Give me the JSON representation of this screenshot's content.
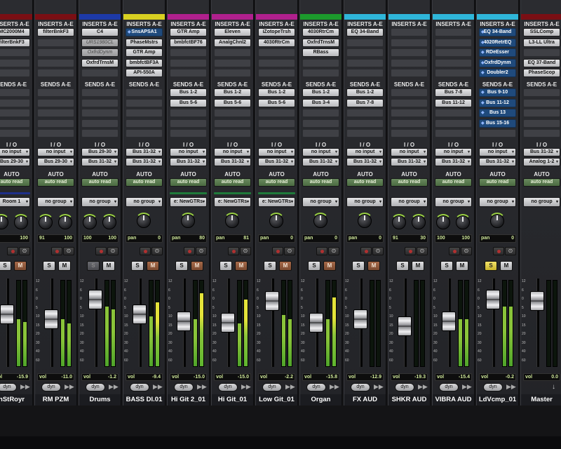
{
  "labels": {
    "inserts": "INSERTS A-E",
    "sends": "SENDS A-E",
    "io": "I / O",
    "auto": "AUTO",
    "vol": "vol",
    "dyn": "dyn"
  },
  "colors": {
    "accent_meter": "#8ac43a",
    "peak_meter": "#e4e33a",
    "selected_slot": "#1f4a7c"
  },
  "channels": [
    {
      "name": "nStRoyr",
      "color": "#7a0f14",
      "inserts": [
        "MC2000M4",
        "filterBnkF3",
        "",
        "",
        ""
      ],
      "sends": [
        "",
        "",
        "",
        "",
        ""
      ],
      "input": "no input",
      "output": "Bus 29-30",
      "auto": "auto read",
      "group": "Room 1",
      "group_stripe": "#1e2f8a",
      "pan_l": "7",
      "pan_r": "100",
      "solo": "S",
      "mute": "M",
      "vol": "-15.9",
      "fader": 0.62,
      "meters": [
        0.55,
        0.52
      ],
      "meter_peak": 0.0
    },
    {
      "name": "RM PZM",
      "color": "#7a0f14",
      "inserts": [
        "filterBnkF3",
        "",
        "",
        "",
        ""
      ],
      "sends": [
        "",
        "",
        "",
        "",
        ""
      ],
      "input": "no input",
      "output": "Bus 29-30",
      "auto": "auto read",
      "group": "no group",
      "group_stripe": "",
      "pan_l": "91",
      "pan_r": "100",
      "solo": "S",
      "mute": "M",
      "vol": "-11.0",
      "fader": 0.55,
      "meters": [
        0.55,
        0.5
      ],
      "meter_peak": 0.0
    },
    {
      "name": "Drums",
      "color": "#1d3aa8",
      "inserts": [
        "C4",
        "URS1980CL",
        "OxfrdDynm",
        "OxfrdTrnsM",
        ""
      ],
      "sends": [
        "",
        "",
        "",
        "",
        ""
      ],
      "input": "Bus 29-30",
      "output": "Bus 31-32",
      "auto": "auto read",
      "group": "no group",
      "group_stripe": "",
      "pan_l": "100",
      "pan_r": "100",
      "solo": "S",
      "mute": "M",
      "vol": "-1.2",
      "fader": 0.82,
      "meters": [
        0.7,
        0.66
      ],
      "meter_peak": 0.0
    },
    {
      "name": "BASS DI.01",
      "color": "#d8d021",
      "inserts": [
        "SnsAPSA1",
        "PhaseMstrs",
        "GTR Amp",
        "bmbfctBF3A",
        "API-550A"
      ],
      "sends": [
        "",
        "",
        "",
        "",
        ""
      ],
      "input": "Bus 31-32",
      "output": "Bus 31-32",
      "auto": "auto read",
      "group": "no group",
      "group_stripe": "",
      "pan_l": "pan",
      "pan_r": "0",
      "solo": "S",
      "mute": "M",
      "vol": "-9.4",
      "fader": 0.62,
      "meters": [
        0.58,
        0.75
      ],
      "meter_peak": 1.0
    },
    {
      "name": "Hi Git 2_01",
      "color": "#b0208d",
      "inserts": [
        "GTR Amp",
        "bmbfctBF76",
        "",
        "",
        ""
      ],
      "sends": [
        "Bus 1-2",
        "Bus 5-6",
        "",
        "",
        ""
      ],
      "input": "no input",
      "output": "Bus 31-32",
      "auto": "auto read",
      "group": "e: NewGTRs",
      "group_stripe": "#1f7a3a",
      "pan_l": "pan",
      "pan_r": "80",
      "solo": "S",
      "mute": "M",
      "vol": "-15.0",
      "fader": 0.52,
      "meters": [
        0.55,
        0.85
      ],
      "meter_peak": 1.0
    },
    {
      "name": "Hi Git_01",
      "color": "#b0208d",
      "inserts": [
        "Eleven",
        "AnalgChnl2",
        "",
        "",
        ""
      ],
      "sends": [
        "Bus 1-2",
        "Bus 5-6",
        "",
        "",
        ""
      ],
      "input": "no input",
      "output": "Bus 31-32",
      "auto": "auto read",
      "group": "e: NewGTRs",
      "group_stripe": "#1f7a3a",
      "pan_l": "pan",
      "pan_r": "81",
      "solo": "S",
      "mute": "M",
      "vol": "-15.0",
      "fader": 0.5,
      "meters": [
        0.5,
        0.78
      ],
      "meter_peak": 1.0
    },
    {
      "name": "Low Git_01",
      "color": "#b0208d",
      "inserts": [
        "iZotopeTrsh",
        "4030RtrCm",
        "",
        "",
        ""
      ],
      "sends": [
        "Bus 1-2",
        "Bus 5-6",
        "",
        "",
        ""
      ],
      "input": "no input",
      "output": "Bus 31-32",
      "auto": "auto read",
      "group": "e: NewGTRs",
      "group_stripe": "#1f7a3a",
      "pan_l": "pan",
      "pan_r": "0",
      "solo": "S",
      "mute": "M",
      "vol": "-2.2",
      "fader": 0.8,
      "meters": [
        0.6,
        0.55
      ],
      "meter_peak": 0.0
    },
    {
      "name": "Organ",
      "color": "#1c9a2c",
      "inserts": [
        "4030RtrCm",
        "OxfrdTrnsM",
        "RBass",
        "",
        ""
      ],
      "sends": [
        "Bus 1-2",
        "Bus 3-4",
        "",
        "",
        ""
      ],
      "input": "no input",
      "output": "Bus 31-32",
      "auto": "auto read",
      "group": "no group",
      "group_stripe": "",
      "pan_l": "pan",
      "pan_r": "0",
      "solo": "S",
      "mute": "M",
      "vol": "-15.8",
      "fader": 0.5,
      "meters": [
        0.55,
        0.8
      ],
      "meter_peak": 1.0
    },
    {
      "name": "FX AUD",
      "color": "#2fb6d9",
      "inserts": [
        "EQ 34-Band",
        "",
        "",
        "",
        ""
      ],
      "sends": [
        "Bus 1-2",
        "Bus 7-8",
        "",
        "",
        ""
      ],
      "input": "no input",
      "output": "Bus 31-32",
      "auto": "auto read",
      "group": "no group",
      "group_stripe": "",
      "pan_l": "pan",
      "pan_r": "0",
      "solo": "S",
      "mute": "M",
      "vol": "-12.9",
      "fader": 0.55,
      "meters": [
        0.0,
        0.0
      ],
      "meter_peak": 0.0
    },
    {
      "name": "SHKR AUD",
      "color": "#2fb6d9",
      "inserts": [
        "",
        "",
        "",
        "",
        ""
      ],
      "sends": [
        "",
        "",
        "",
        "",
        ""
      ],
      "input": "no input",
      "output": "Bus 31-32",
      "auto": "auto read",
      "group": "no group",
      "group_stripe": "",
      "pan_l": "91",
      "pan_r": "30",
      "solo": "S",
      "mute": "M",
      "vol": "-19.3",
      "fader": 0.45,
      "meters": [
        0.0,
        0.0
      ],
      "meter_peak": 0.0
    },
    {
      "name": "VIBRA AUD",
      "color": "#2fb6d9",
      "inserts": [
        "",
        "",
        "",
        "",
        ""
      ],
      "sends": [
        "Bus 7-8",
        "Bus 11-12",
        "",
        "",
        ""
      ],
      "input": "no input",
      "output": "Bus 31-32",
      "auto": "auto read",
      "group": "no group",
      "group_stripe": "",
      "pan_l": "100",
      "pan_r": "100",
      "solo": "S",
      "mute": "M",
      "vol": "-15.4",
      "fader": 0.52,
      "meters": [
        0.55,
        0.55
      ],
      "meter_peak": 0.0
    },
    {
      "name": "LdVcmp_01",
      "color": "#2fb6d9",
      "inserts": [
        "EQ 34-Band",
        "4020RetrEQ",
        "RDeEsser",
        "OxfrdDynm",
        "Doubler2"
      ],
      "sends": [
        "Bus 9-10",
        "Bus 11-12",
        "Bus 13",
        "Bus 15-16",
        ""
      ],
      "input": "no input",
      "output": "Bus 31-32",
      "auto": "auto read",
      "group": "no group",
      "group_stripe": "",
      "pan_l": "pan",
      "pan_r": "0",
      "solo": "S",
      "mute": "M",
      "vol": "-0.2",
      "fader": 0.82,
      "meters": [
        0.7,
        0.7
      ],
      "meter_peak": 0.0
    },
    {
      "name": "Master",
      "color": "#7a0f14",
      "inserts": [
        "SSLComp",
        "L3-LL Ultra",
        "",
        "EQ 37-Band",
        "PhaseScop"
      ],
      "sends": [
        "",
        "",
        "",
        "",
        ""
      ],
      "input": "Bus 31-32",
      "output": "Analog 1-2",
      "auto": "auto read",
      "group": "no group",
      "group_stripe": "",
      "pan_l": "",
      "pan_r": "",
      "solo": "",
      "mute": "",
      "vol": "0.0",
      "fader": 0.8,
      "meters": [
        0.0,
        0.0
      ],
      "meter_peak": 0.0
    }
  ],
  "scale_ticks": [
    "12",
    "6",
    "0",
    "5",
    "10",
    "15",
    "20",
    "30",
    "40",
    "60"
  ]
}
